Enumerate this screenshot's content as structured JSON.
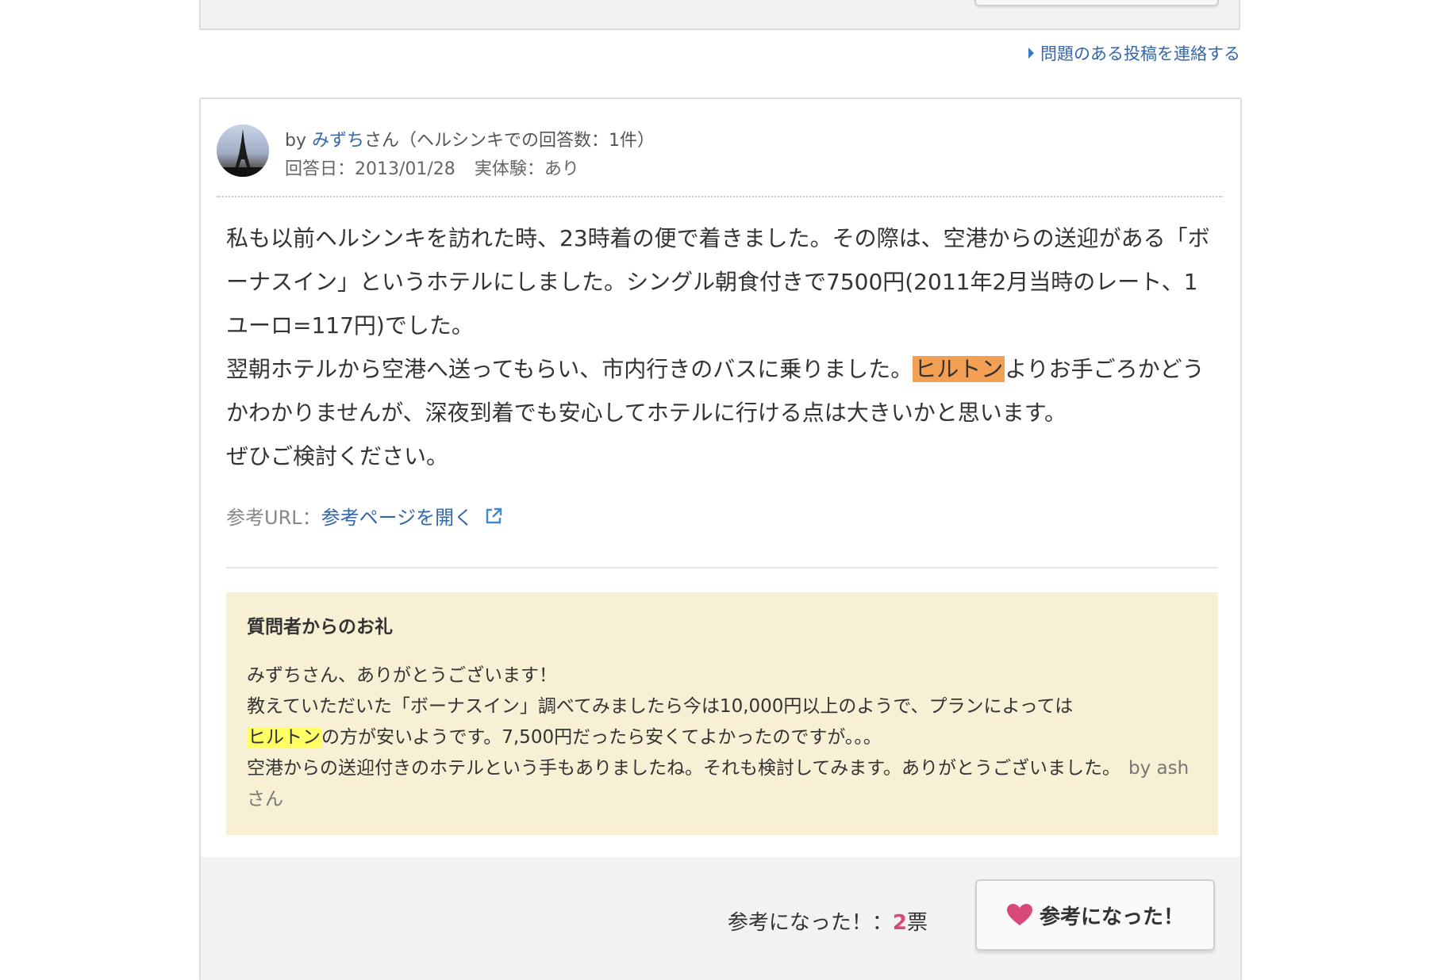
{
  "report_link": {
    "label": "問題のある投稿を連絡する"
  },
  "answer": {
    "author_prefix": "by ",
    "author_name": "みずち",
    "author_suffix": "さん（ヘルシンキでの回答数：1件）",
    "date": "回答日：2013/01/28",
    "experience": "実体験：あり",
    "body": {
      "line1_pre": "私も以前ヘルシンキを訪れた時、23時着の便で着きました。その際は、空港からの送迎がある「ボーナスイン」というホテルにしました。シングル朝食付きで7500円(2011年2月当時のレート、1ユーロ=117円)でした。",
      "line2_pre": "翌朝ホテルから空港へ送ってもらい、市内行きのバスに乗りました。",
      "highlight": "ヒルトン",
      "line2_post": "よりお手ごろかどうかわかりませんが、深夜到着でも安心してホテルに行ける点は大きいかと思います。",
      "line3": "ぜひご検討ください。"
    },
    "ref_url_label": "参考URL：",
    "ref_url_link": "参考ページを開く",
    "ext_icon": "external-link-icon"
  },
  "thanks": {
    "title": "質問者からのお礼",
    "line1": "みずちさん、ありがとうございます！",
    "line2": "教えていただいた「ボーナスイン」調べてみましたら今は10,000円以上のようで、プランによっては",
    "highlight": "ヒルトン",
    "line3_post": "の方が安いようです。7,500円だったら安くてよかったのですが。。。",
    "line4": "空港からの送迎付きのホテルという手もありましたね。それも検討してみます。ありがとうございました。",
    "by": "by ashさん"
  },
  "vote": {
    "label_pre": "参考になった！：",
    "count": "2",
    "label_post": "票",
    "button_label": "参考になった！",
    "heart_color": "#d9487a"
  }
}
